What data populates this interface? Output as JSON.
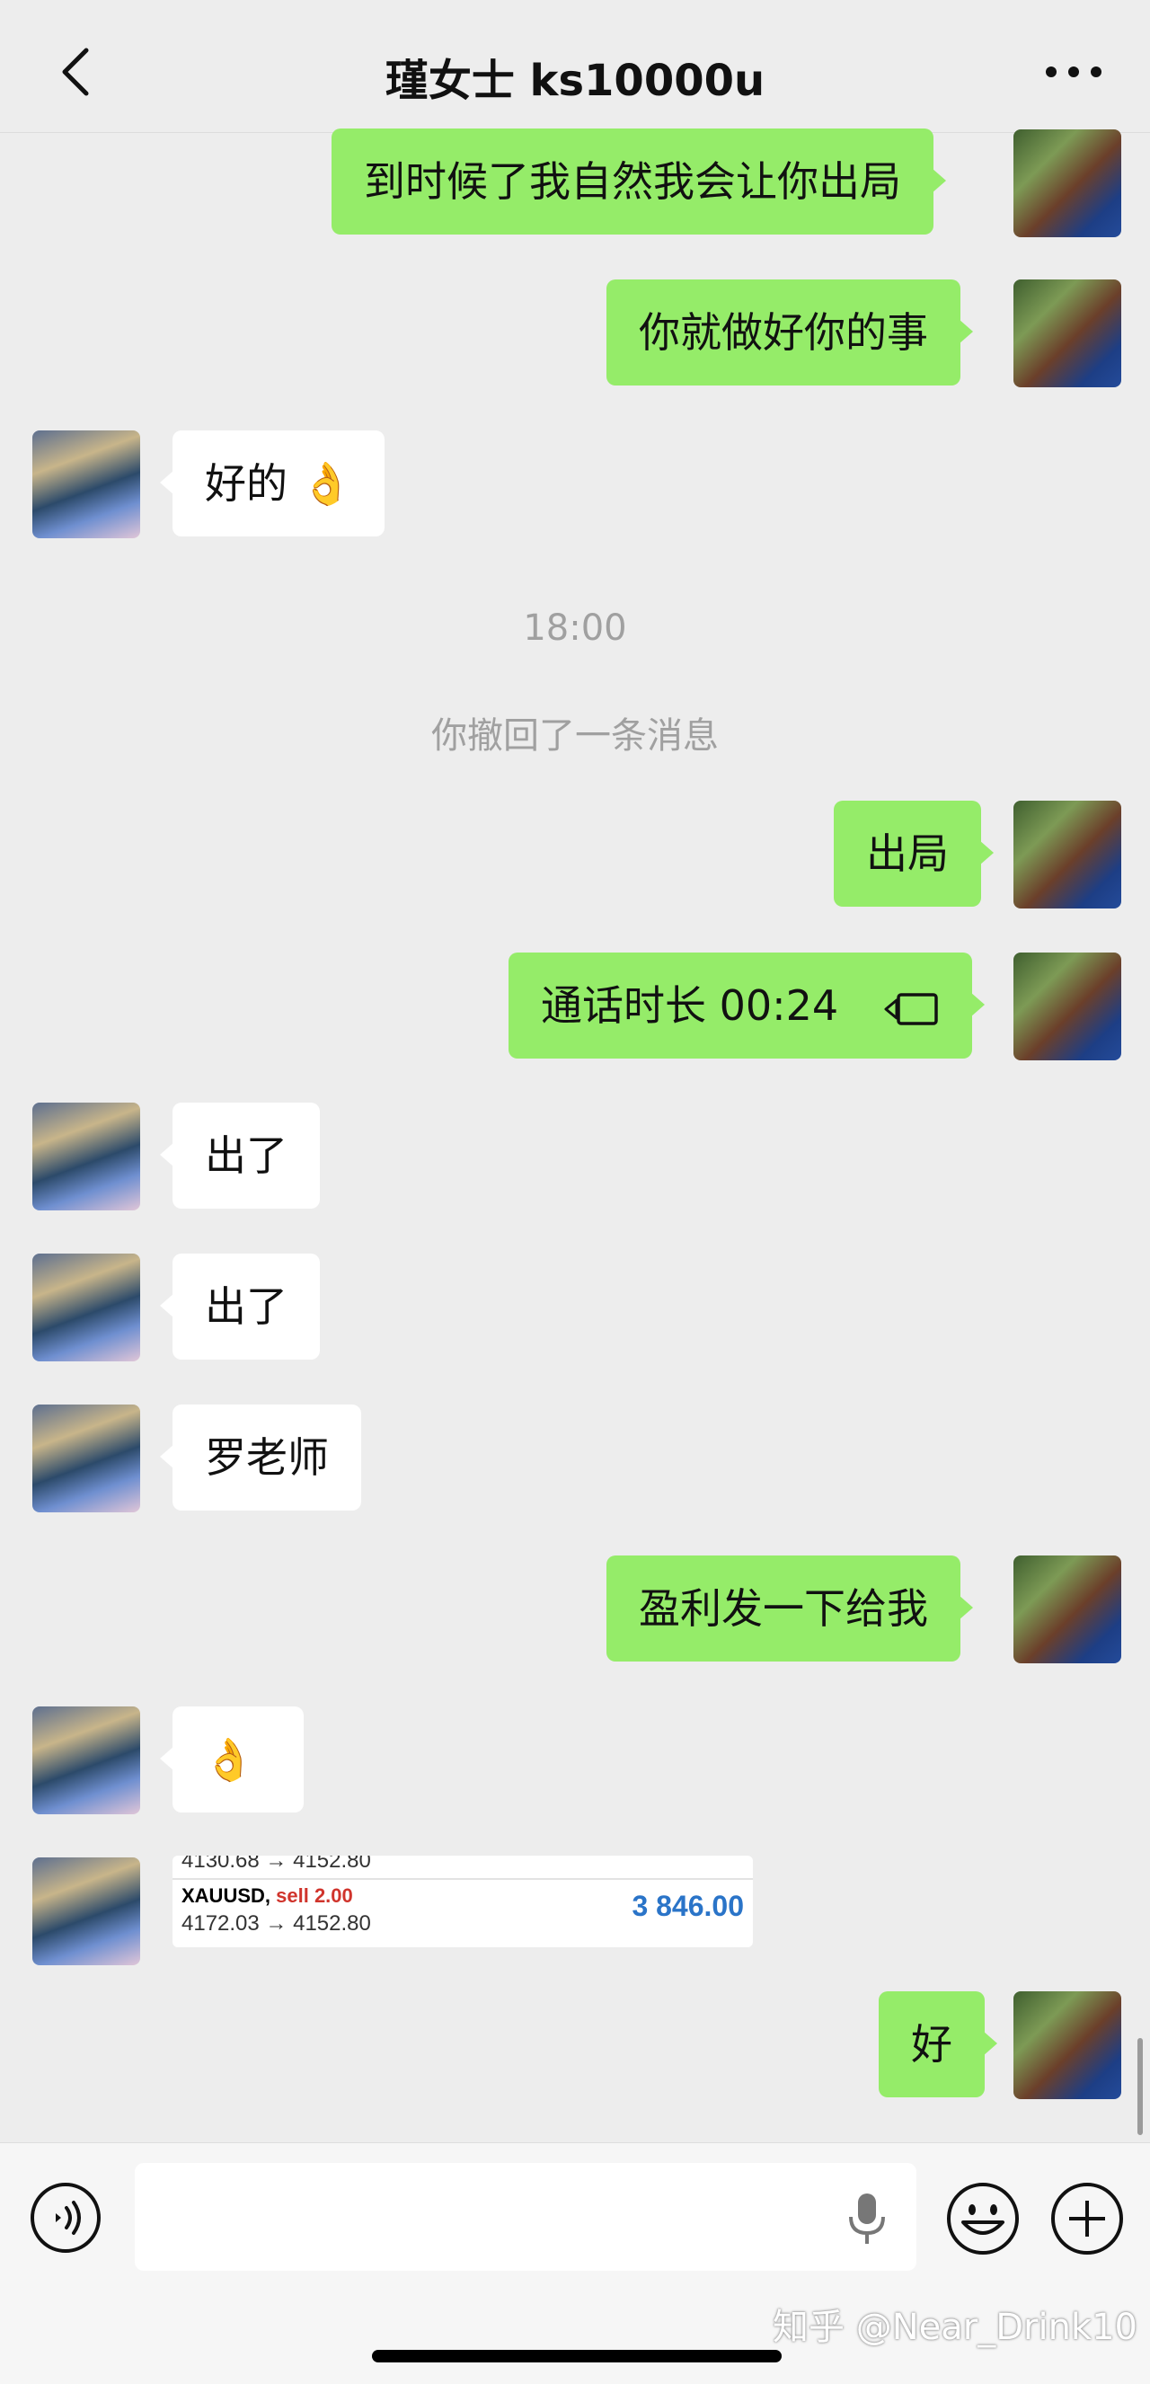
{
  "header": {
    "title": "瑾女士 ks10000u"
  },
  "messages": {
    "m1": "到时候了我自然我会让你出局",
    "m2": "你就做好你的事",
    "m3": "好的",
    "m3_emoji": "👌",
    "time": "18:00",
    "recall": "你撤回了一条消息",
    "m4": "出局",
    "m5": "通话时长 00:24",
    "m6": "出了",
    "m7": "出了",
    "m8": "罗老师",
    "m9": "盈利发一下给我",
    "m10_emoji": "👌",
    "m11": "好"
  },
  "trade": {
    "row1_prices": "4130.68 → 4152.80",
    "row2_symbol": "XAUUSD,",
    "row2_side": "sell 2.00",
    "row2_prices": "4172.03 → 4152.80",
    "row2_value": "3 846.00"
  },
  "footer": {
    "watermark": "知乎 @Near_Drink10"
  },
  "colors": {
    "my_bubble": "#95ec69",
    "other_bubble": "#ffffff",
    "background": "#ededed"
  },
  "icons": [
    "back-arrow-icon",
    "more-icon",
    "call-icon",
    "voice-icon",
    "mic-icon",
    "emoji-icon",
    "plus-icon"
  ]
}
